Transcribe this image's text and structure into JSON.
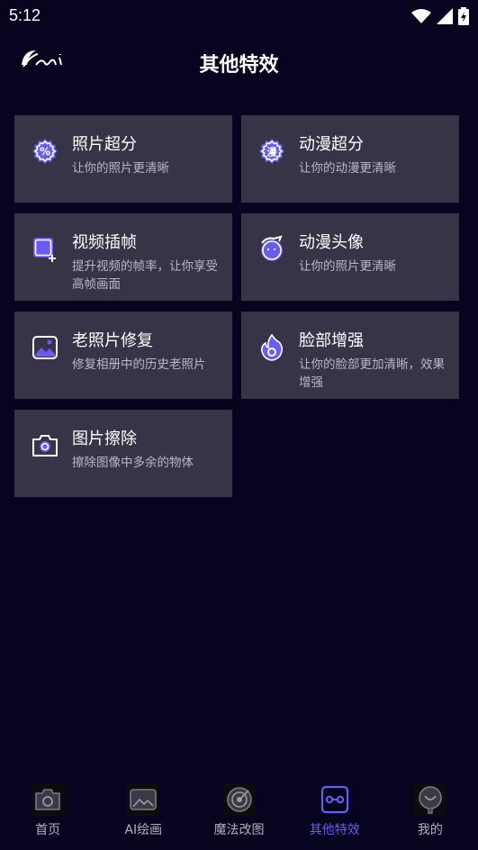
{
  "status_bar": {
    "time": "5:12"
  },
  "header": {
    "title": "其他特效"
  },
  "cards": [
    {
      "title": "照片超分",
      "desc": "让你的照片更清晰",
      "icon": "percent-badge-icon"
    },
    {
      "title": "动漫超分",
      "desc": "让你的动漫更清晰",
      "icon": "anime-badge-icon",
      "icon_text": "漫"
    },
    {
      "title": "视频插帧",
      "desc": "提升视频的帧率，让你享受高帧画面",
      "icon": "video-add-icon"
    },
    {
      "title": "动漫头像",
      "desc": "让你的照片更清晰",
      "icon": "anime-face-icon"
    },
    {
      "title": "老照片修复",
      "desc": "修复相册中的历史老照片",
      "icon": "image-icon"
    },
    {
      "title": "脸部增强",
      "desc": "让你的脸部更加清晰，效果增强",
      "icon": "flame-icon"
    },
    {
      "title": "图片擦除",
      "desc": "擦除图像中多余的物体",
      "icon": "camera-icon"
    }
  ],
  "nav": [
    {
      "label": "首页",
      "icon": "camera-icon"
    },
    {
      "label": "AI绘画",
      "icon": "picture-icon"
    },
    {
      "label": "魔法改图",
      "icon": "radar-icon"
    },
    {
      "label": "其他特效",
      "icon": "link-icon",
      "active": true
    },
    {
      "label": "我的",
      "icon": "profile-icon"
    }
  ],
  "colors": {
    "background": "#07041f",
    "card": "#373448",
    "accent": "#6a5cf0"
  }
}
